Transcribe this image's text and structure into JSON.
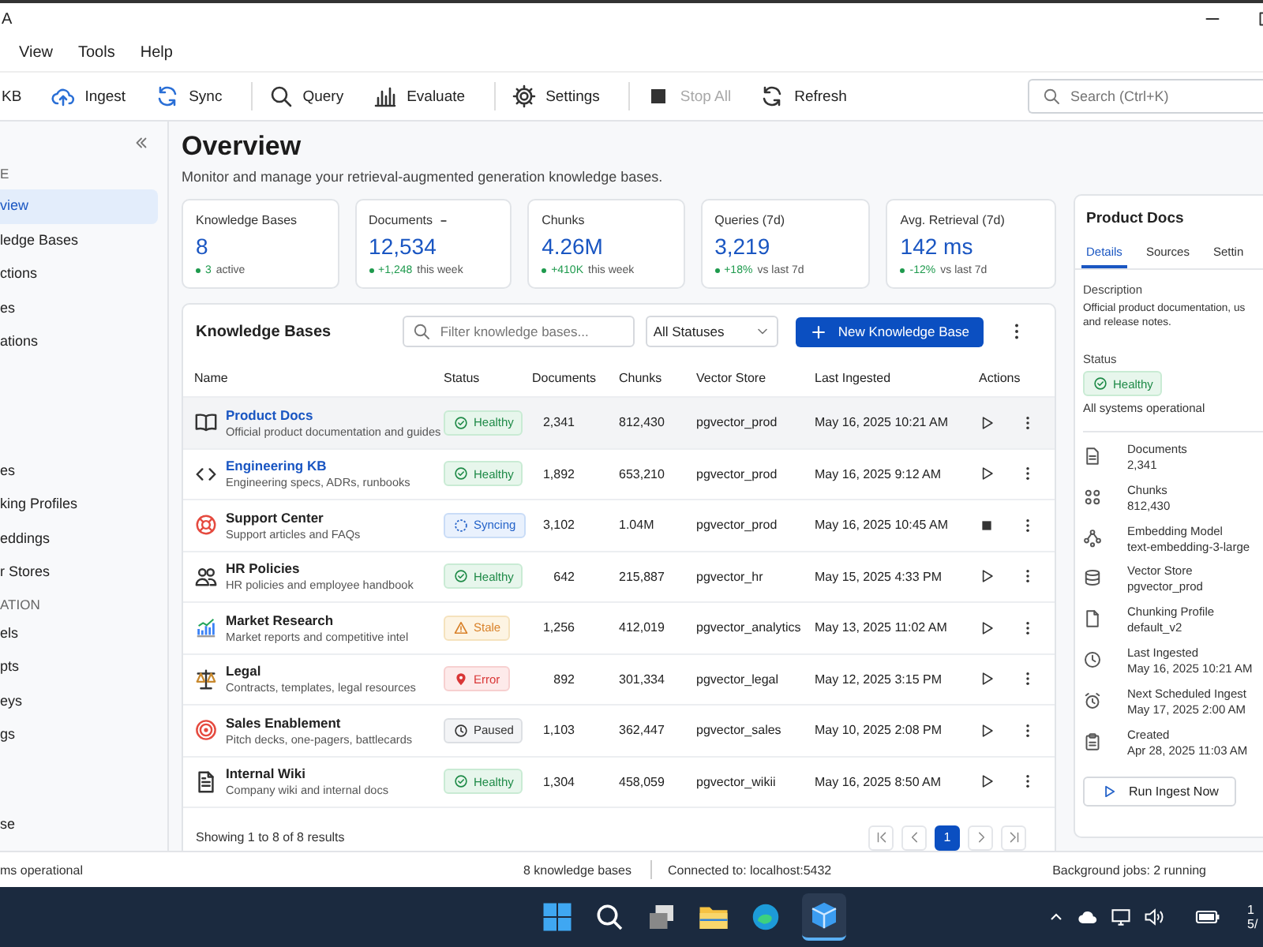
{
  "window": {
    "title": "A"
  },
  "menu": [
    "View",
    "Tools",
    "Help"
  ],
  "toolbar": [
    [
      {
        "label": "KB",
        "disabled": false
      },
      {
        "label": "Ingest",
        "disabled": false
      },
      {
        "label": "Sync",
        "disabled": false
      }
    ],
    [
      {
        "label": "Query",
        "disabled": false
      },
      {
        "label": "Evaluate",
        "disabled": false
      }
    ],
    [
      {
        "label": "Settings",
        "disabled": false
      }
    ],
    [
      {
        "label": "Stop All",
        "disabled": true
      },
      {
        "label": "Refresh",
        "disabled": false
      }
    ]
  ],
  "search": {
    "placeholder": "Search (Ctrl+K)"
  },
  "sidebar": {
    "sections": [
      {
        "heading": "E",
        "items": [
          {
            "label": "view",
            "selected": true
          },
          {
            "label": "ledge Bases",
            "selected": false
          },
          {
            "label": "ctions",
            "selected": false
          },
          {
            "label": "es",
            "selected": false
          },
          {
            "label": "ations",
            "selected": false
          }
        ]
      },
      {
        "items": [
          {
            "label": "es",
            "selected": false
          },
          {
            "label": "king Profiles",
            "selected": false
          },
          {
            "label": "eddings",
            "selected": false
          },
          {
            "label": "r Stores",
            "selected": false
          }
        ]
      },
      {
        "heading": "ATION",
        "items": [
          {
            "label": "els",
            "selected": false
          },
          {
            "label": "pts",
            "selected": false
          },
          {
            "label": "eys",
            "selected": false
          },
          {
            "label": "gs",
            "selected": false
          }
        ]
      }
    ],
    "footer_item": "se"
  },
  "page": {
    "title": "Overview",
    "subtitle": "Monitor and manage your retrieval-augmented generation knowledge bases."
  },
  "stats": [
    {
      "label": "Knowledge Bases",
      "has_menu": false,
      "value": "8",
      "delta": "3",
      "note": "active"
    },
    {
      "label": "Documents",
      "has_menu": true,
      "value": "12,534",
      "delta": "+1,248",
      "note": "this week"
    },
    {
      "label": "Chunks",
      "has_menu": false,
      "value": "4.26M",
      "delta": "+410K",
      "note": "this week"
    },
    {
      "label": "Queries (7d)",
      "has_menu": false,
      "value": "3,219",
      "delta": "+18%",
      "note": "vs last 7d"
    },
    {
      "label": "Avg. Retrieval (7d)",
      "has_menu": false,
      "value": "142 ms",
      "delta": "-12%",
      "note": "vs last 7d"
    }
  ],
  "table": {
    "title": "Knowledge Bases",
    "filter_placeholder": "Filter knowledge bases...",
    "status_filter": "All Statuses",
    "new_button": "New Knowledge Base",
    "columns": [
      "Name",
      "Status",
      "Documents",
      "Chunks",
      "Vector Store",
      "Last Ingested",
      "Actions"
    ],
    "rows": [
      {
        "name": "Product Docs",
        "link": true,
        "selected": true,
        "description": "Official product documentation and guides",
        "status": {
          "kind": "healthy",
          "label": "Healthy"
        },
        "documents": "2,341",
        "chunks": "812,430",
        "vector_store": "pgvector_prod",
        "last_ingested": "May 16, 2025 10:21 AM",
        "running": false
      },
      {
        "name": "Engineering KB",
        "link": true,
        "selected": false,
        "description": "Engineering specs, ADRs, runbooks",
        "status": {
          "kind": "healthy",
          "label": "Healthy"
        },
        "documents": "1,892",
        "chunks": "653,210",
        "vector_store": "pgvector_prod",
        "last_ingested": "May 16, 2025 9:12 AM",
        "running": false
      },
      {
        "name": "Support Center",
        "link": false,
        "selected": false,
        "description": "Support articles and FAQs",
        "status": {
          "kind": "syncing",
          "label": "Syncing"
        },
        "documents": "3,102",
        "chunks": "1.04M",
        "vector_store": "pgvector_prod",
        "last_ingested": "May 16, 2025 10:45 AM",
        "running": true
      },
      {
        "name": "HR Policies",
        "link": false,
        "selected": false,
        "description": "HR policies and employee handbook",
        "status": {
          "kind": "healthy",
          "label": "Healthy"
        },
        "documents": "642",
        "chunks": "215,887",
        "vector_store": "pgvector_hr",
        "last_ingested": "May 15, 2025 4:33 PM",
        "running": false
      },
      {
        "name": "Market Research",
        "link": false,
        "selected": false,
        "description": "Market reports and competitive intel",
        "status": {
          "kind": "stale",
          "label": "Stale"
        },
        "documents": "1,256",
        "chunks": "412,019",
        "vector_store": "pgvector_analytics",
        "last_ingested": "May 13, 2025 11:02 AM",
        "running": false
      },
      {
        "name": "Legal",
        "link": false,
        "selected": false,
        "description": "Contracts, templates, legal resources",
        "status": {
          "kind": "error",
          "label": "Error"
        },
        "documents": "892",
        "chunks": "301,334",
        "vector_store": "pgvector_legal",
        "last_ingested": "May 12, 2025 3:15 PM",
        "running": false
      },
      {
        "name": "Sales Enablement",
        "link": false,
        "selected": false,
        "description": "Pitch decks, one-pagers, battlecards",
        "status": {
          "kind": "paused",
          "label": "Paused"
        },
        "documents": "1,103",
        "chunks": "362,447",
        "vector_store": "pgvector_sales",
        "last_ingested": "May 10, 2025 2:08 PM",
        "running": false
      },
      {
        "name": "Internal Wiki",
        "link": false,
        "selected": false,
        "description": "Company wiki and internal docs",
        "status": {
          "kind": "healthy",
          "label": "Healthy"
        },
        "documents": "1,304",
        "chunks": "458,059",
        "vector_store": "pgvector_wikii",
        "last_ingested": "May 16, 2025 8:50 AM",
        "running": false
      }
    ],
    "summary": "Showing 1 to 8 of 8 results",
    "pages": [
      {
        "label": "1",
        "selected": true
      }
    ]
  },
  "detail": {
    "title": "Product Docs",
    "tabs": [
      {
        "label": "Details",
        "selected": true
      },
      {
        "label": "Sources",
        "selected": false
      },
      {
        "label": "Settin",
        "selected": false
      }
    ],
    "description_label": "Description",
    "description_lines": [
      "Official product documentation, us",
      "and release notes."
    ],
    "status_label": "Status",
    "status": {
      "kind": "healthy",
      "label": "Healthy"
    },
    "status_note": "All systems operational",
    "properties": [
      {
        "label": "Documents",
        "value": "2,341"
      },
      {
        "label": "Chunks",
        "value": "812,430"
      },
      {
        "label": "Embedding Model",
        "value": "text-embedding-3-large"
      },
      {
        "label": "Vector Store",
        "value": "pgvector_prod"
      },
      {
        "label": "Chunking Profile",
        "value": "default_v2"
      },
      {
        "label": "Last Ingested",
        "value": "May 16, 2025 10:21 AM"
      },
      {
        "label": "Next Scheduled Ingest",
        "value": "May 17, 2025 2:00 AM"
      },
      {
        "label": "Created",
        "value": "Apr 28, 2025 11:03 AM"
      }
    ],
    "button": "Run Ingest Now"
  },
  "status_bar": {
    "left": "ms operational",
    "count": "8 knowledge bases",
    "connection": "Connected to: localhost:5432",
    "jobs": "Background jobs: 2 running"
  },
  "taskbar": {
    "clock_lines": [
      "1",
      "5/"
    ]
  }
}
